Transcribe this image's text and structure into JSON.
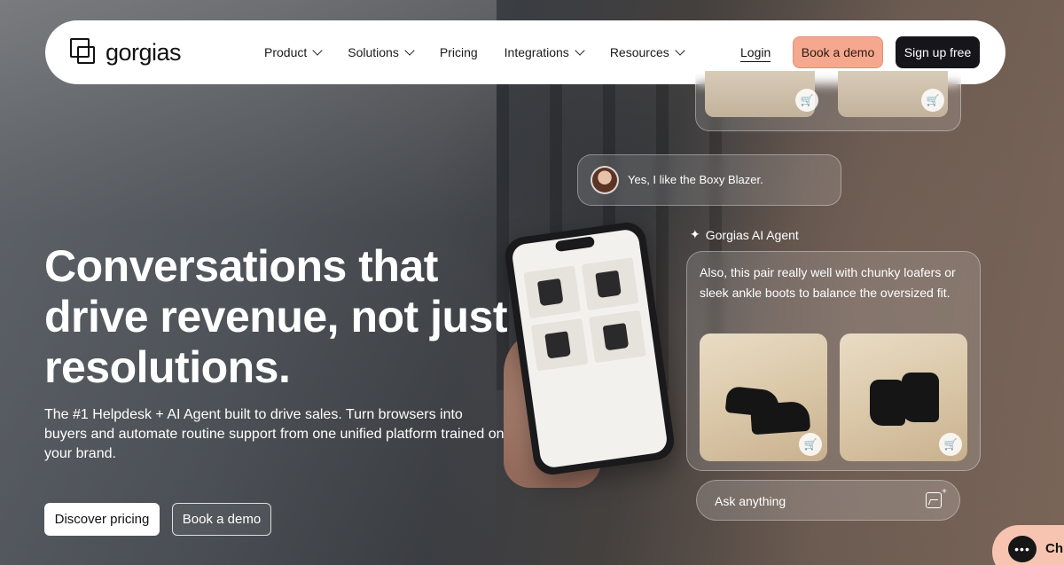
{
  "brand": {
    "name": "gorgias"
  },
  "nav": {
    "items": [
      {
        "label": "Product",
        "has_dropdown": true
      },
      {
        "label": "Solutions",
        "has_dropdown": true
      },
      {
        "label": "Pricing",
        "has_dropdown": false
      },
      {
        "label": "Integrations",
        "has_dropdown": true
      },
      {
        "label": "Resources",
        "has_dropdown": true
      }
    ],
    "login": "Login",
    "book_demo": "Book a demo",
    "signup": "Sign up free"
  },
  "hero": {
    "headline": "Conversations that drive revenue, not just resolutions.",
    "subtext": "The #1 Helpdesk + AI Agent built to drive sales. Turn browsers into buyers and automate routine support from one unified platform trained on your brand.",
    "primary_cta": "Discover pricing",
    "secondary_cta": "Book a demo"
  },
  "chat_demo": {
    "user_message": "Yes, I like the Boxy Blazer.",
    "agent_name": "Gorgias AI Agent",
    "agent_message": "Also, this pair really well with chunky loafers or sleek ankle boots to balance the oversized fit.",
    "ask_placeholder": "Ask anything",
    "cart_icon": "🛒"
  },
  "chat_widget": {
    "label": "Ch"
  },
  "colors": {
    "accent": "#f6a88f",
    "dark": "#16161a",
    "widget": "#f6c4b0"
  }
}
